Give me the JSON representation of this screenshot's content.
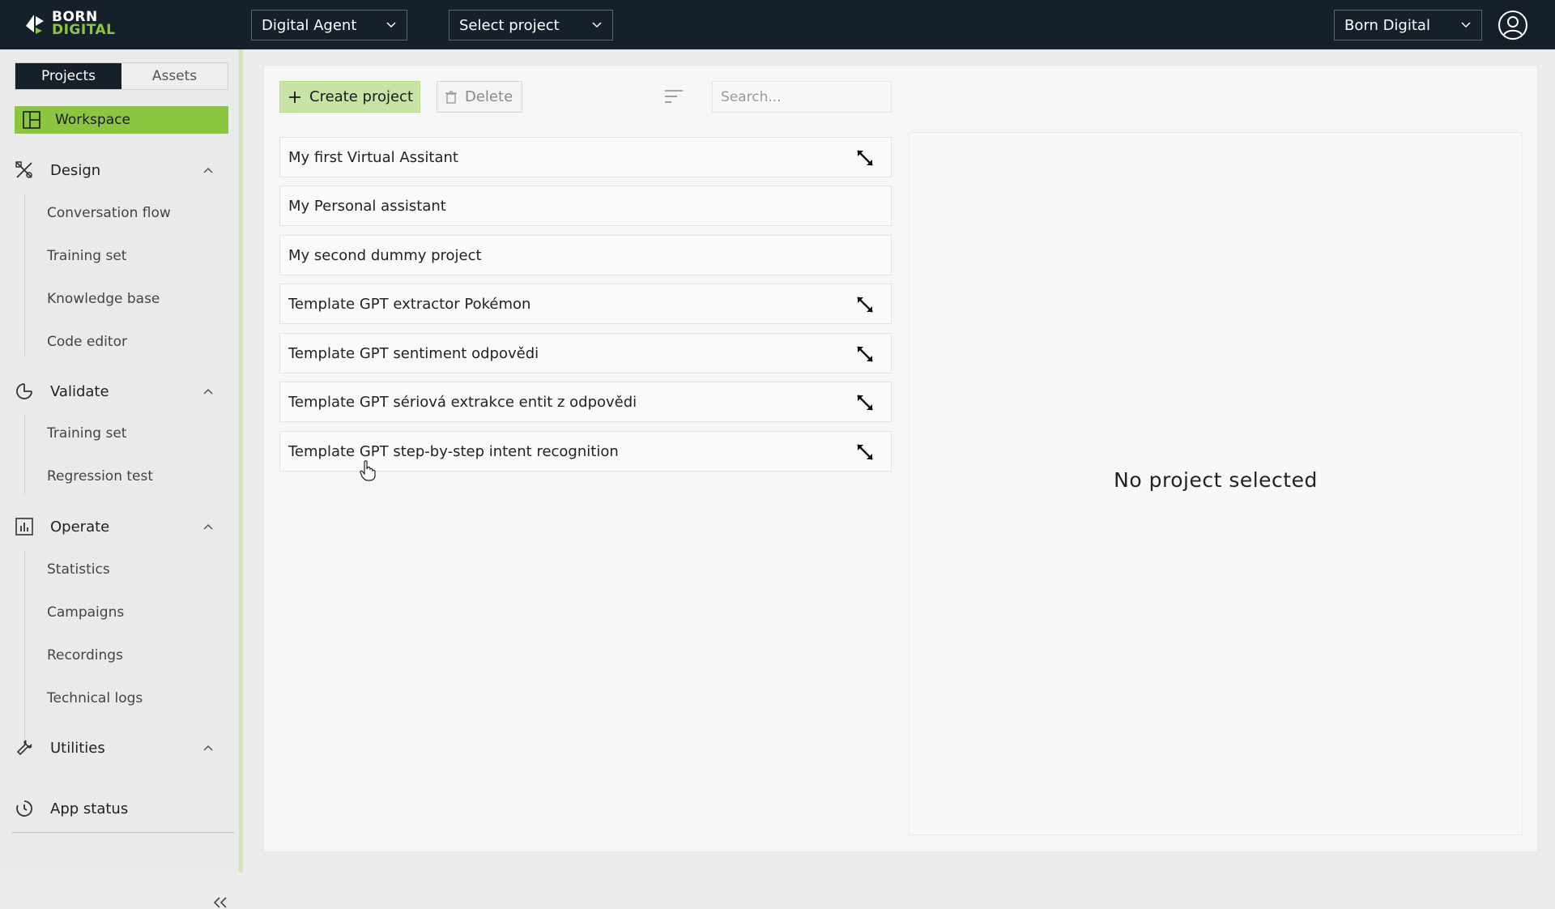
{
  "header": {
    "logo": {
      "line1": "BORN",
      "line2": "DIGITAL"
    },
    "agent_select": "Digital Agent",
    "project_select": "Select project",
    "org_select": "Born Digital"
  },
  "sidebar": {
    "tabs": [
      {
        "label": "Projects",
        "active": true
      },
      {
        "label": "Assets",
        "active": false
      }
    ],
    "workspace": "Workspace",
    "sections": [
      {
        "label": "Design",
        "icon": "design-tools-icon",
        "items": [
          "Conversation flow",
          "Training set",
          "Knowledge base",
          "Code editor"
        ]
      },
      {
        "label": "Validate",
        "icon": "validate-chart-icon",
        "items": [
          "Training set",
          "Regression test"
        ]
      },
      {
        "label": "Operate",
        "icon": "operate-bar-chart-icon",
        "items": [
          "Statistics",
          "Campaigns",
          "Recordings",
          "Technical logs"
        ]
      },
      {
        "label": "Utilities",
        "icon": "wrench-icon",
        "items": []
      }
    ],
    "app_status": "App status"
  },
  "toolbar": {
    "create_label": "Create project",
    "delete_label": "Delete",
    "search_placeholder": "Search..."
  },
  "projects": [
    {
      "name": "My first Virtual Assitant",
      "expand": true
    },
    {
      "name": "My Personal assistant",
      "expand": false
    },
    {
      "name": "My second dummy project",
      "expand": false
    },
    {
      "name": "Template GPT extractor Pokémon",
      "expand": true
    },
    {
      "name": "Template GPT sentiment odpovědi",
      "expand": true
    },
    {
      "name": "Template GPT sériová extrakce entit z odpovědi",
      "expand": true
    },
    {
      "name": "Template GPT step-by-step intent recognition",
      "expand": true
    }
  ],
  "detail": {
    "empty_text": "No project selected"
  },
  "colors": {
    "accent": "#8cc63f",
    "topbar": "#16202a",
    "accent_light": "#c8e3a6"
  }
}
